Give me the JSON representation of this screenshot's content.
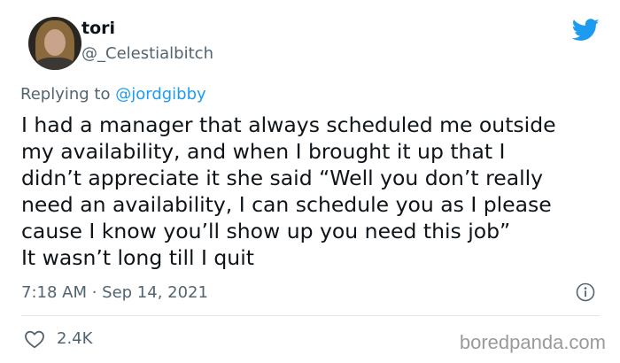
{
  "author": {
    "display_name": "tori",
    "handle": "@_Celestialbitch"
  },
  "reply_context": {
    "prefix": "Replying to",
    "mention": "@jordgibby"
  },
  "tweet": {
    "lines": [
      "I had a manager that always scheduled me outside",
      "my availability, and when I brought it up that I",
      "didn’t appreciate it she said “Well you don’t really",
      "need an availability, I can schedule you as I please",
      "cause I know you’ll show up you need this job”",
      "It wasn’t long till I quit"
    ],
    "timestamp": "7:18 AM · Sep 14, 2021",
    "likes": "2.4K"
  },
  "watermark": "boredpanda.com",
  "icons": {
    "brand": "twitter-bird-icon",
    "info": "info-icon",
    "like": "heart-icon"
  },
  "colors": {
    "brand_blue": "#1d9bf0",
    "secondary_text": "#536471",
    "primary_text": "#0f1419"
  }
}
